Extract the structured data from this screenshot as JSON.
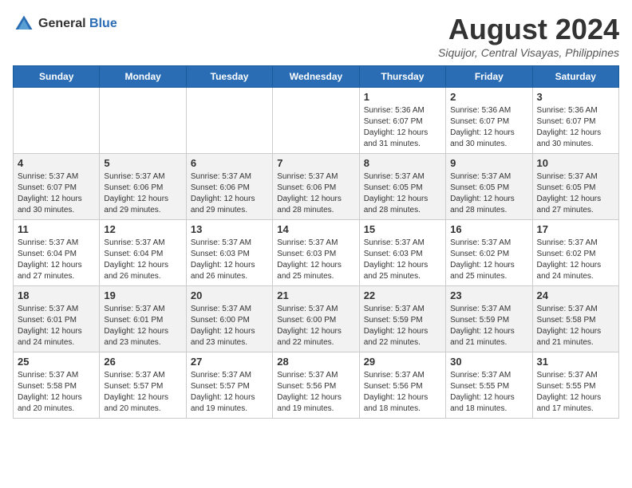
{
  "logo": {
    "general": "General",
    "blue": "Blue"
  },
  "header": {
    "title": "August 2024",
    "subtitle": "Siquijor, Central Visayas, Philippines"
  },
  "days": [
    "Sunday",
    "Monday",
    "Tuesday",
    "Wednesday",
    "Thursday",
    "Friday",
    "Saturday"
  ],
  "weeks": [
    {
      "cells": [
        {
          "day": "",
          "info": ""
        },
        {
          "day": "",
          "info": ""
        },
        {
          "day": "",
          "info": ""
        },
        {
          "day": "",
          "info": ""
        },
        {
          "day": "1",
          "info": "Sunrise: 5:36 AM\nSunset: 6:07 PM\nDaylight: 12 hours\nand 31 minutes."
        },
        {
          "day": "2",
          "info": "Sunrise: 5:36 AM\nSunset: 6:07 PM\nDaylight: 12 hours\nand 30 minutes."
        },
        {
          "day": "3",
          "info": "Sunrise: 5:36 AM\nSunset: 6:07 PM\nDaylight: 12 hours\nand 30 minutes."
        }
      ]
    },
    {
      "cells": [
        {
          "day": "4",
          "info": "Sunrise: 5:37 AM\nSunset: 6:07 PM\nDaylight: 12 hours\nand 30 minutes."
        },
        {
          "day": "5",
          "info": "Sunrise: 5:37 AM\nSunset: 6:06 PM\nDaylight: 12 hours\nand 29 minutes."
        },
        {
          "day": "6",
          "info": "Sunrise: 5:37 AM\nSunset: 6:06 PM\nDaylight: 12 hours\nand 29 minutes."
        },
        {
          "day": "7",
          "info": "Sunrise: 5:37 AM\nSunset: 6:06 PM\nDaylight: 12 hours\nand 28 minutes."
        },
        {
          "day": "8",
          "info": "Sunrise: 5:37 AM\nSunset: 6:05 PM\nDaylight: 12 hours\nand 28 minutes."
        },
        {
          "day": "9",
          "info": "Sunrise: 5:37 AM\nSunset: 6:05 PM\nDaylight: 12 hours\nand 28 minutes."
        },
        {
          "day": "10",
          "info": "Sunrise: 5:37 AM\nSunset: 6:05 PM\nDaylight: 12 hours\nand 27 minutes."
        }
      ]
    },
    {
      "cells": [
        {
          "day": "11",
          "info": "Sunrise: 5:37 AM\nSunset: 6:04 PM\nDaylight: 12 hours\nand 27 minutes."
        },
        {
          "day": "12",
          "info": "Sunrise: 5:37 AM\nSunset: 6:04 PM\nDaylight: 12 hours\nand 26 minutes."
        },
        {
          "day": "13",
          "info": "Sunrise: 5:37 AM\nSunset: 6:03 PM\nDaylight: 12 hours\nand 26 minutes."
        },
        {
          "day": "14",
          "info": "Sunrise: 5:37 AM\nSunset: 6:03 PM\nDaylight: 12 hours\nand 25 minutes."
        },
        {
          "day": "15",
          "info": "Sunrise: 5:37 AM\nSunset: 6:03 PM\nDaylight: 12 hours\nand 25 minutes."
        },
        {
          "day": "16",
          "info": "Sunrise: 5:37 AM\nSunset: 6:02 PM\nDaylight: 12 hours\nand 25 minutes."
        },
        {
          "day": "17",
          "info": "Sunrise: 5:37 AM\nSunset: 6:02 PM\nDaylight: 12 hours\nand 24 minutes."
        }
      ]
    },
    {
      "cells": [
        {
          "day": "18",
          "info": "Sunrise: 5:37 AM\nSunset: 6:01 PM\nDaylight: 12 hours\nand 24 minutes."
        },
        {
          "day": "19",
          "info": "Sunrise: 5:37 AM\nSunset: 6:01 PM\nDaylight: 12 hours\nand 23 minutes."
        },
        {
          "day": "20",
          "info": "Sunrise: 5:37 AM\nSunset: 6:00 PM\nDaylight: 12 hours\nand 23 minutes."
        },
        {
          "day": "21",
          "info": "Sunrise: 5:37 AM\nSunset: 6:00 PM\nDaylight: 12 hours\nand 22 minutes."
        },
        {
          "day": "22",
          "info": "Sunrise: 5:37 AM\nSunset: 5:59 PM\nDaylight: 12 hours\nand 22 minutes."
        },
        {
          "day": "23",
          "info": "Sunrise: 5:37 AM\nSunset: 5:59 PM\nDaylight: 12 hours\nand 21 minutes."
        },
        {
          "day": "24",
          "info": "Sunrise: 5:37 AM\nSunset: 5:58 PM\nDaylight: 12 hours\nand 21 minutes."
        }
      ]
    },
    {
      "cells": [
        {
          "day": "25",
          "info": "Sunrise: 5:37 AM\nSunset: 5:58 PM\nDaylight: 12 hours\nand 20 minutes."
        },
        {
          "day": "26",
          "info": "Sunrise: 5:37 AM\nSunset: 5:57 PM\nDaylight: 12 hours\nand 20 minutes."
        },
        {
          "day": "27",
          "info": "Sunrise: 5:37 AM\nSunset: 5:57 PM\nDaylight: 12 hours\nand 19 minutes."
        },
        {
          "day": "28",
          "info": "Sunrise: 5:37 AM\nSunset: 5:56 PM\nDaylight: 12 hours\nand 19 minutes."
        },
        {
          "day": "29",
          "info": "Sunrise: 5:37 AM\nSunset: 5:56 PM\nDaylight: 12 hours\nand 18 minutes."
        },
        {
          "day": "30",
          "info": "Sunrise: 5:37 AM\nSunset: 5:55 PM\nDaylight: 12 hours\nand 18 minutes."
        },
        {
          "day": "31",
          "info": "Sunrise: 5:37 AM\nSunset: 5:55 PM\nDaylight: 12 hours\nand 17 minutes."
        }
      ]
    }
  ]
}
